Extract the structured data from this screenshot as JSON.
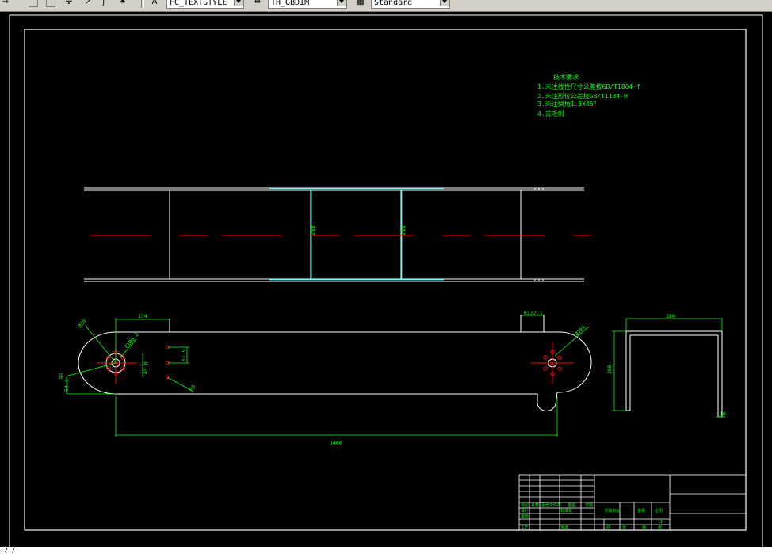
{
  "toolbar": {
    "text_style": "FC_TEXTSTYLE",
    "dim_style": "TH_GBDIM",
    "table_style": "Standard"
  },
  "notes": {
    "heading": "技术要求",
    "lines": [
      "1.未注线性尺寸公差按GB/T1804-f",
      "2.未注形位公差按GB/T1184-H",
      "3.未注倒角1.5X45°",
      "4.去毛刺"
    ]
  },
  "dimensions": {
    "d1": "174",
    "d2": "1400",
    "d3": "R172.1",
    "d4": "Ø36",
    "d5": "8XØ8.2",
    "d6": "61.9",
    "d7": "45.8",
    "d8": "R8",
    "d9": "54.4",
    "d10": "R5",
    "d11": "Ø184",
    "d12": "288",
    "d13": "288",
    "d14": "280",
    "d15": "200",
    "d16": "10"
  },
  "title_block": {
    "cells": [
      "标记",
      "处数",
      "更改文件号",
      "签名",
      "日期",
      "设计",
      "标准化",
      "阶段标记",
      "重量",
      "比例",
      "11",
      "审核",
      "工艺",
      "批准",
      "共",
      "张",
      "第",
      "张"
    ]
  },
  "command_line": ":2 /",
  "colors": {
    "background": "#000000",
    "geometry": "#ffffff",
    "dimension": "#00ff00",
    "centerline": "#ff0000",
    "construction": "#00e5ee"
  }
}
